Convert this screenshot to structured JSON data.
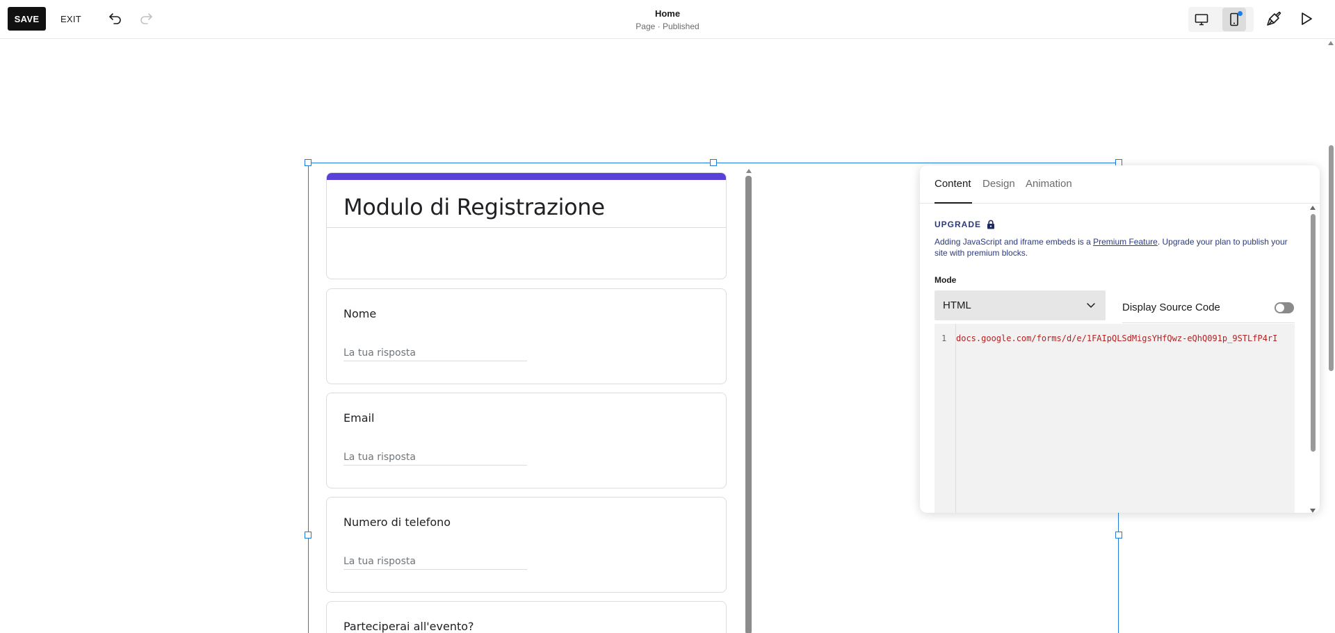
{
  "toolbar": {
    "save_label": "SAVE",
    "exit_label": "EXIT",
    "page_title": "Home",
    "page_status": "Page · Published"
  },
  "icons": {
    "undo": "undo-arrow",
    "redo": "redo-arrow",
    "desktop": "desktop-monitor",
    "mobile": "mobile-phone",
    "design": "paint-brush",
    "preview": "play-triangle",
    "lock": "padlock",
    "chevron": "chevron-down"
  },
  "colors": {
    "accent_blue": "#1f7be0",
    "form_accent": "#5741d9",
    "upgrade_text": "#2a3a7c",
    "code_text": "#b22222"
  },
  "form": {
    "title": "Modulo di Registrazione",
    "questions": [
      {
        "label": "Nome",
        "placeholder": "La tua risposta"
      },
      {
        "label": "Email",
        "placeholder": "La tua risposta"
      },
      {
        "label": "Numero di telefono",
        "placeholder": "La tua risposta"
      },
      {
        "label": "Parteciperai all'evento?"
      }
    ]
  },
  "panel": {
    "tabs": [
      {
        "label": "Content",
        "active": true
      },
      {
        "label": "Design",
        "active": false
      },
      {
        "label": "Animation",
        "active": false
      }
    ],
    "upgrade": {
      "label": "UPGRADE",
      "desc_before": "Adding JavaScript and iframe embeds is a ",
      "desc_link": "Premium Feature",
      "desc_after": ". Upgrade your plan to publish your site with premium blocks."
    },
    "mode": {
      "label": "Mode",
      "value": "HTML"
    },
    "display_source": {
      "label": "Display Source Code",
      "enabled": false
    },
    "code": {
      "line_number": "1",
      "line_text": "docs.google.com/forms/d/e/1FAIpQLSdMigsYHfQwz-eQhQ091p_9STLfP4rI"
    }
  }
}
